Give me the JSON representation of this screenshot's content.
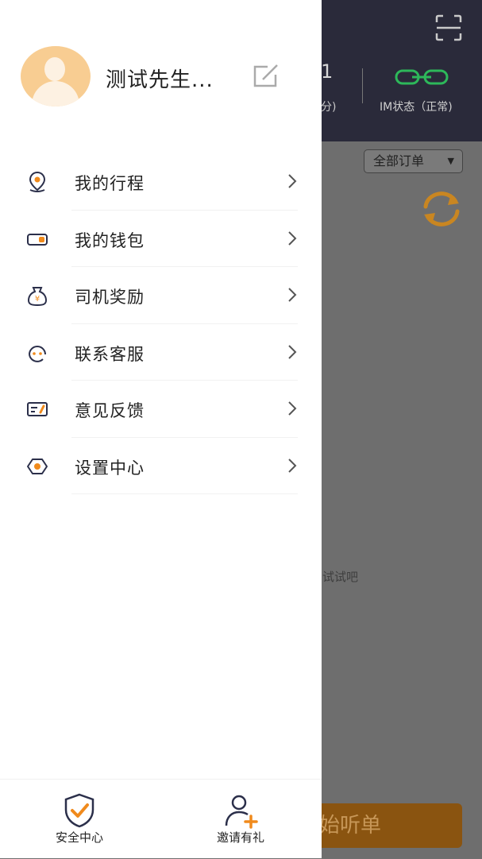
{
  "background": {
    "stat_value": "1",
    "stat_unit": "分)",
    "im_status_label": "IM状态（正常)",
    "order_filter": "全部订单",
    "empty_hint": "试试吧",
    "listen_button": "始听单",
    "colors": {
      "top": "#2a2a3a",
      "im_icon": "#2db85a",
      "refresh": "#c98621"
    }
  },
  "drawer": {
    "user_name": "测试先生...",
    "menu": [
      {
        "label": "我的行程",
        "icon": "location-pin-icon"
      },
      {
        "label": "我的钱包",
        "icon": "wallet-icon"
      },
      {
        "label": "司机奖励",
        "icon": "money-bag-icon"
      },
      {
        "label": "联系客服",
        "icon": "customer-service-icon"
      },
      {
        "label": "意见反馈",
        "icon": "feedback-icon"
      },
      {
        "label": "设置中心",
        "icon": "settings-icon"
      }
    ],
    "bottom": [
      {
        "label": "安全中心",
        "icon": "shield-check-icon"
      },
      {
        "label": "邀请有礼",
        "icon": "invite-user-icon"
      }
    ],
    "colors": {
      "accent": "#f08a1c",
      "icon_dark": "#2b2f4a"
    }
  }
}
